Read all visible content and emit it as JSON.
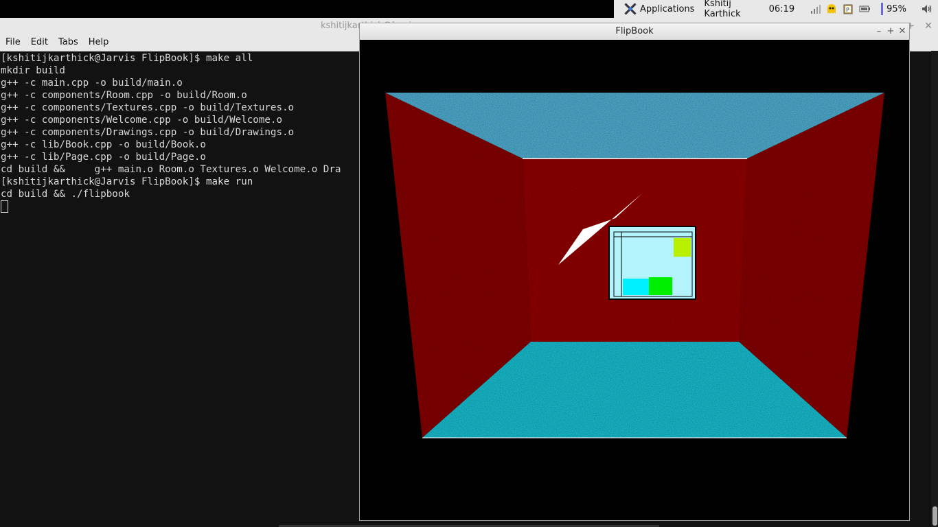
{
  "panel": {
    "applications_label": "Applications",
    "user_name": "Kshitij Karthick",
    "clock": "06:19",
    "battery": "95%",
    "icons": [
      "applications-icon",
      "network-signal-icon",
      "ghost-icon",
      "clipboard-icon",
      "battery-icon",
      "volume-icon"
    ]
  },
  "terminal": {
    "title": "kshitijkarthick@Jarvis",
    "menu": [
      "File",
      "Edit",
      "Tabs",
      "Help"
    ],
    "lines": [
      "[kshitijkarthick@Jarvis FlipBook]$ make all",
      "mkdir build",
      "g++ -c main.cpp -o build/main.o",
      "g++ -c components/Room.cpp -o build/Room.o",
      "g++ -c components/Textures.cpp -o build/Textures.o",
      "g++ -c components/Welcome.cpp -o build/Welcome.o",
      "g++ -c components/Drawings.cpp -o build/Drawings.o",
      "g++ -c lib/Book.cpp -o build/Book.o",
      "g++ -c lib/Page.cpp -o build/Page.o",
      "cd build &&     g++ main.o Room.o Textures.o Welcome.o Dra",
      "[kshitijkarthick@Jarvis FlipBook]$ make run",
      "cd build && ./flipbook"
    ]
  },
  "flipbook": {
    "title": "FlipBook",
    "colors": {
      "ceiling": "#4aa3c4",
      "wall_back": "#8a0000",
      "wall_side": "#7e0000",
      "floor": "#16b3c4",
      "frame_bg": "#b3f3fb",
      "lime": "#b8f000",
      "cyan": "#00f0ff",
      "green": "#00ee00"
    }
  }
}
